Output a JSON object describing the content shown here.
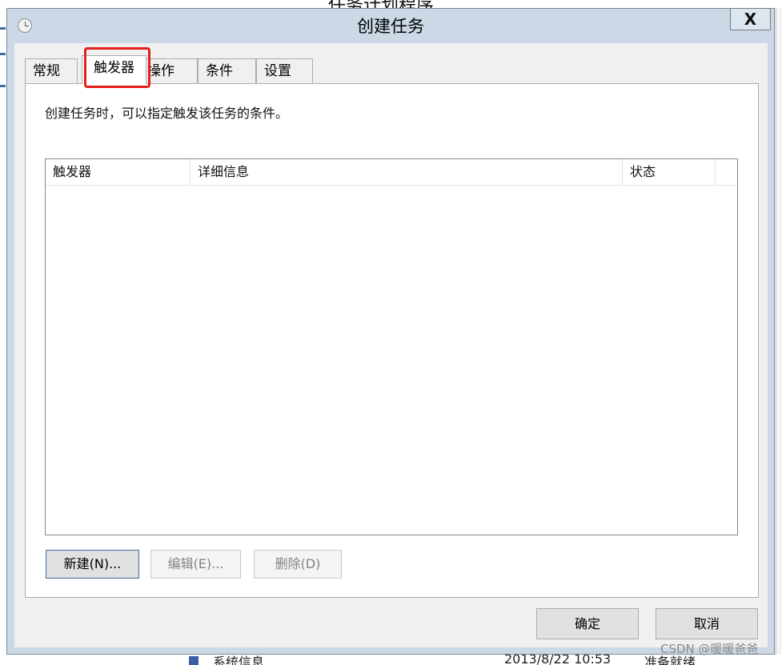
{
  "background": {
    "top_title": "任务计划程序",
    "bottom_row": {
      "name": "系统信息",
      "date": "2013/8/22 10:53",
      "status": "准备就绪"
    }
  },
  "dialog": {
    "title": "创建任务",
    "close_label": "X",
    "tabs": [
      {
        "label": "常规",
        "active": false
      },
      {
        "label": "触发器",
        "active": true
      },
      {
        "label": "操作",
        "active": false
      },
      {
        "label": "条件",
        "active": false
      },
      {
        "label": "设置",
        "active": false
      }
    ],
    "triggers_panel": {
      "description": "创建任务时，可以指定触发该任务的条件。",
      "columns": [
        "触发器",
        "详细信息",
        "状态"
      ],
      "rows": [],
      "buttons": {
        "new": "新建(N)...",
        "edit": "编辑(E)...",
        "delete": "删除(D)"
      }
    },
    "footer": {
      "ok": "确定",
      "cancel": "取消"
    }
  },
  "watermark": "CSDN @暖暖爸爸",
  "colors": {
    "highlight_box": "#e3201b",
    "titlebar_bg": "#cbd9e6"
  }
}
